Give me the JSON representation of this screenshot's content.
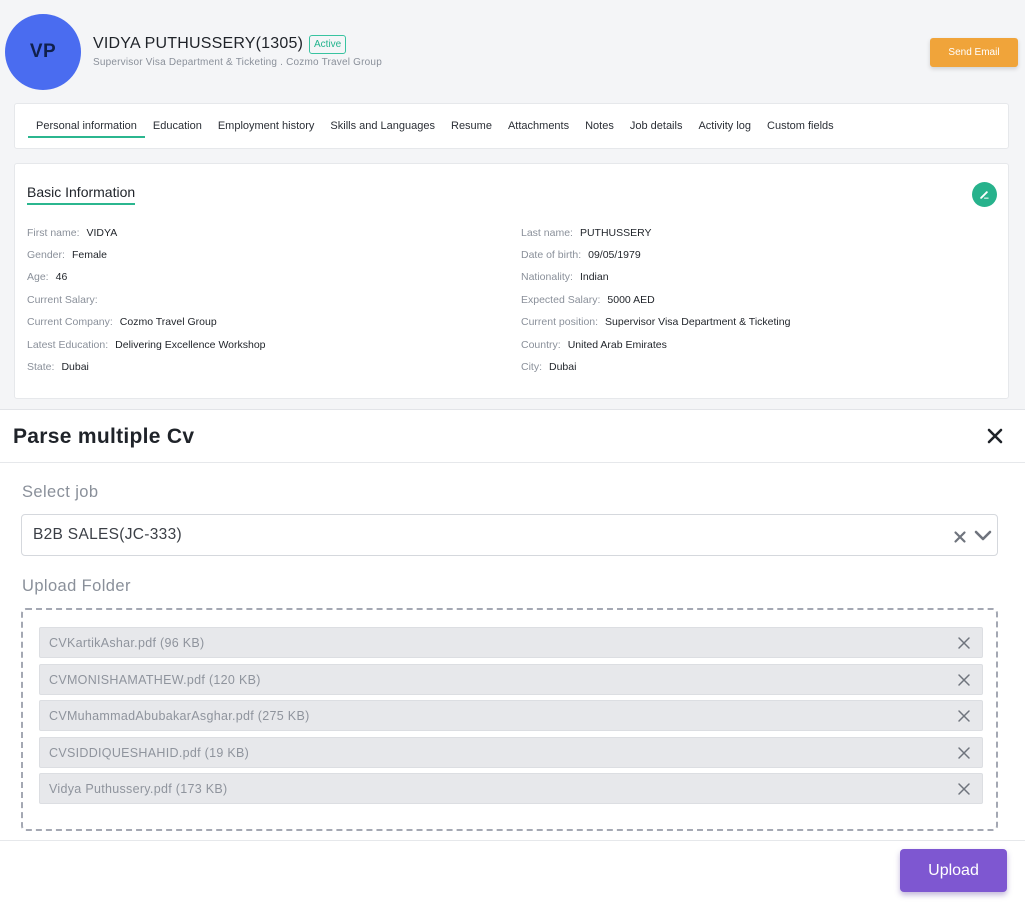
{
  "profile": {
    "initials": "VP",
    "name": "VIDYA PUTHUSSERY(1305)",
    "status": "Active",
    "subtitle": "Supervisor Visa Department & Ticketing . Cozmo Travel Group",
    "send_email_label": "Send Email",
    "avatar_color": "#4a6cf0"
  },
  "tabs": [
    {
      "label": "Personal information",
      "active": true
    },
    {
      "label": "Education"
    },
    {
      "label": "Employment history"
    },
    {
      "label": "Skills and Languages"
    },
    {
      "label": "Resume"
    },
    {
      "label": "Attachments"
    },
    {
      "label": "Notes"
    },
    {
      "label": "Job details"
    },
    {
      "label": "Activity log"
    },
    {
      "label": "Custom fields"
    }
  ],
  "basic_info": {
    "title": "Basic Information",
    "left": [
      {
        "label": "First name:",
        "value": "VIDYA"
      },
      {
        "label": "Gender:",
        "value": "Female"
      },
      {
        "label": "Age:",
        "value": "46"
      },
      {
        "label": "Current Salary:",
        "value": ""
      },
      {
        "label": "Current Company:",
        "value": "Cozmo Travel Group"
      },
      {
        "label": "Latest Education:",
        "value": "Delivering Excellence Workshop"
      },
      {
        "label": "State:",
        "value": "Dubai"
      }
    ],
    "right": [
      {
        "label": "Last name:",
        "value": "PUTHUSSERY"
      },
      {
        "label": "Date of birth:",
        "value": "09/05/1979"
      },
      {
        "label": "Nationality:",
        "value": "Indian"
      },
      {
        "label": "Expected Salary:",
        "value": "5000 AED"
      },
      {
        "label": "Current position:",
        "value": "Supervisor Visa Department & Ticketing"
      },
      {
        "label": "Country:",
        "value": "United Arab Emirates"
      },
      {
        "label": "City:",
        "value": "Dubai"
      }
    ]
  },
  "modal": {
    "title": "Parse multiple Cv",
    "select_job_label": "Select job",
    "selected_job": "B2B SALES(JC-333)",
    "upload_folder_label": "Upload Folder",
    "files": [
      "CVKartikAshar.pdf (96 KB)",
      "CVMONISHAMATHEW.pdf (120 KB)",
      "CVMuhammadAbubakarAsghar.pdf (275 KB)",
      "CVSIDDIQUESHAHID.pdf (19 KB)",
      "Vidya Puthussery.pdf (173 KB)"
    ],
    "upload_label": "Upload"
  }
}
